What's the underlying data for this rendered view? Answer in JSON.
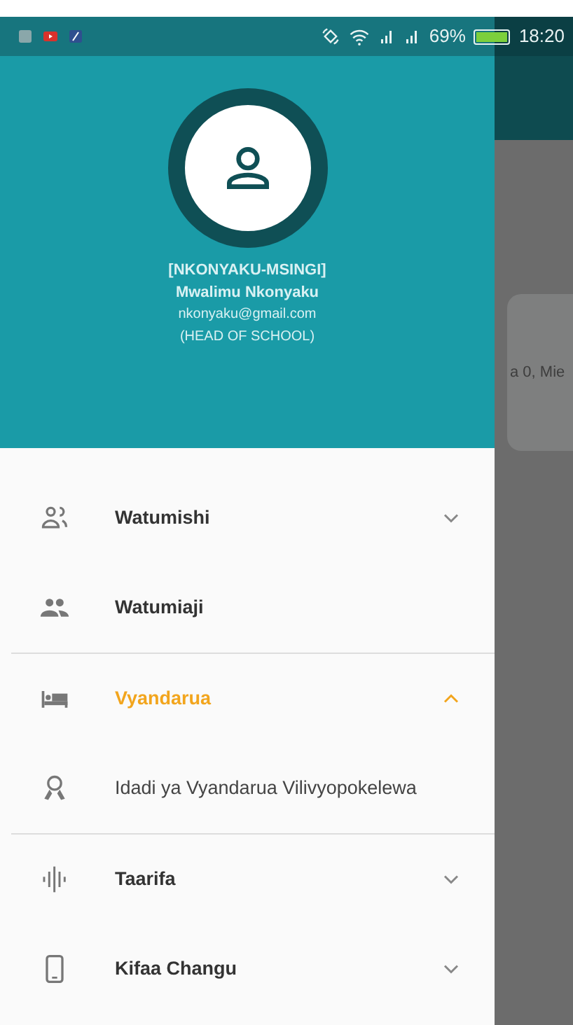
{
  "status_bar": {
    "battery": "69%",
    "time": "18:20"
  },
  "drawer_header": {
    "school": "[NKONYAKU-MSINGI]",
    "name": "Mwalimu Nkonyaku",
    "email": "nkonyaku@gmail.com",
    "role": "(HEAD OF SCHOOL)"
  },
  "menu_sections": [
    {
      "items": [
        {
          "label": "Watumishi",
          "kind": "group",
          "expanded": false
        },
        {
          "label": "Watumiaji",
          "kind": "item"
        }
      ]
    },
    {
      "items": [
        {
          "label": "Vyandarua",
          "kind": "group",
          "expanded": true,
          "children": [
            {
              "label": "Idadi ya Vyandarua Vilivyopokelewa",
              "kind": "subitem"
            }
          ]
        }
      ]
    },
    {
      "items": [
        {
          "label": "Taarifa",
          "kind": "group",
          "expanded": false
        },
        {
          "label": "Kifaa Changu",
          "kind": "group",
          "expanded": false
        }
      ]
    }
  ],
  "background": {
    "card_text": "a 0, Mie"
  }
}
